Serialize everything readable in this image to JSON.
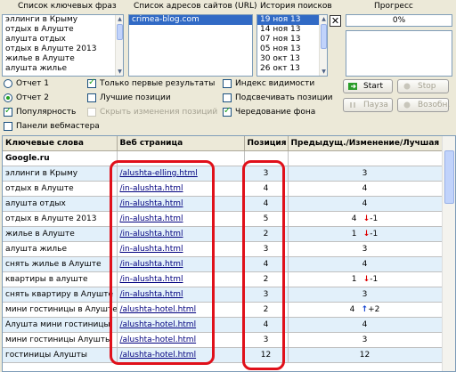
{
  "headers": {
    "keywords_list": "Список ключевых фраз",
    "urls_list": "Список адресов сайтов (URL)",
    "history": "История поисков",
    "progress": "Прогресс"
  },
  "keywords": [
    "эллинги в Крыму",
    "отдых в Алуште",
    "алушта отдых",
    "отдых в Алуште 2013",
    "жилье в Алуште",
    "алушта жилье"
  ],
  "urls": [
    "crimea-blog.com"
  ],
  "history": [
    "19 ноя 13",
    "14 ноя 13",
    "07 ноя 13",
    "05 ноя 13",
    "30 окт 13",
    "26 окт 13"
  ],
  "history_selected": 0,
  "progress": {
    "value": "0%",
    "fraction": 0
  },
  "options": {
    "report1": "Отчет 1",
    "report2": "Отчет 2",
    "popularity": "Популярность",
    "webmaster": "Панели вебмастера",
    "first_results": "Только первые результаты",
    "best_positions": "Лучшие позиции",
    "hide_changes": "Скрыть изменения позиций",
    "visibility_index": "Индекс видимости",
    "highlight_positions": "Подсвечивать позиции",
    "alternate_bg": "Чередование фона"
  },
  "buttons": {
    "start": "Start",
    "stop": "Stop",
    "pause": "Пауза",
    "resume": "Возобн."
  },
  "table": {
    "columns": [
      "Ключевые слова",
      "Веб страница",
      "Позиция",
      "Предыдущ./Изменение/Лучшая"
    ],
    "group": "Google.ru",
    "rows": [
      {
        "kw": "эллинги в Крыму",
        "url": "/alushta-elling.html",
        "pos": "3",
        "prev": "3",
        "delta": "",
        "dir": ""
      },
      {
        "kw": "отдых в Алуште",
        "url": "/in-alushta.html",
        "pos": "4",
        "prev": "4",
        "delta": "",
        "dir": ""
      },
      {
        "kw": "алушта отдых",
        "url": "/in-alushta.html",
        "pos": "4",
        "prev": "4",
        "delta": "",
        "dir": ""
      },
      {
        "kw": "отдых в Алуште 2013",
        "url": "/in-alushta.html",
        "pos": "5",
        "prev": "4",
        "delta": "-1",
        "dir": "down"
      },
      {
        "kw": "жилье в Алуште",
        "url": "/in-alushta.html",
        "pos": "2",
        "prev": "1",
        "delta": "-1",
        "dir": "down"
      },
      {
        "kw": "алушта жилье",
        "url": "/in-alushta.html",
        "pos": "3",
        "prev": "3",
        "delta": "",
        "dir": ""
      },
      {
        "kw": "снять жилье в Алуште",
        "url": "/in-alushta.html",
        "pos": "4",
        "prev": "4",
        "delta": "",
        "dir": ""
      },
      {
        "kw": "квартиры в алуште",
        "url": "/in-alushta.html",
        "pos": "2",
        "prev": "1",
        "delta": "-1",
        "dir": "down"
      },
      {
        "kw": "снять квартиру в Алуште",
        "url": "/in-alushta.html",
        "pos": "3",
        "prev": "3",
        "delta": "",
        "dir": ""
      },
      {
        "kw": "мини гостиницы в Алуште",
        "url": "/alushta-hotel.html",
        "pos": "2",
        "prev": "4",
        "delta": "+2",
        "dir": "up"
      },
      {
        "kw": "Алушта мини гостиницы",
        "url": "/alushta-hotel.html",
        "pos": "4",
        "prev": "4",
        "delta": "",
        "dir": ""
      },
      {
        "kw": "мини гостиницы Алушты",
        "url": "/alushta-hotel.html",
        "pos": "3",
        "prev": "3",
        "delta": "",
        "dir": ""
      },
      {
        "kw": "гостиницы Алушты",
        "url": "/alushta-hotel.html",
        "pos": "12",
        "prev": "12",
        "delta": "",
        "dir": ""
      }
    ]
  },
  "colors": {
    "annotation": "#e0101a",
    "row_highlight": "#e2f0fa",
    "link": "#00007f"
  }
}
